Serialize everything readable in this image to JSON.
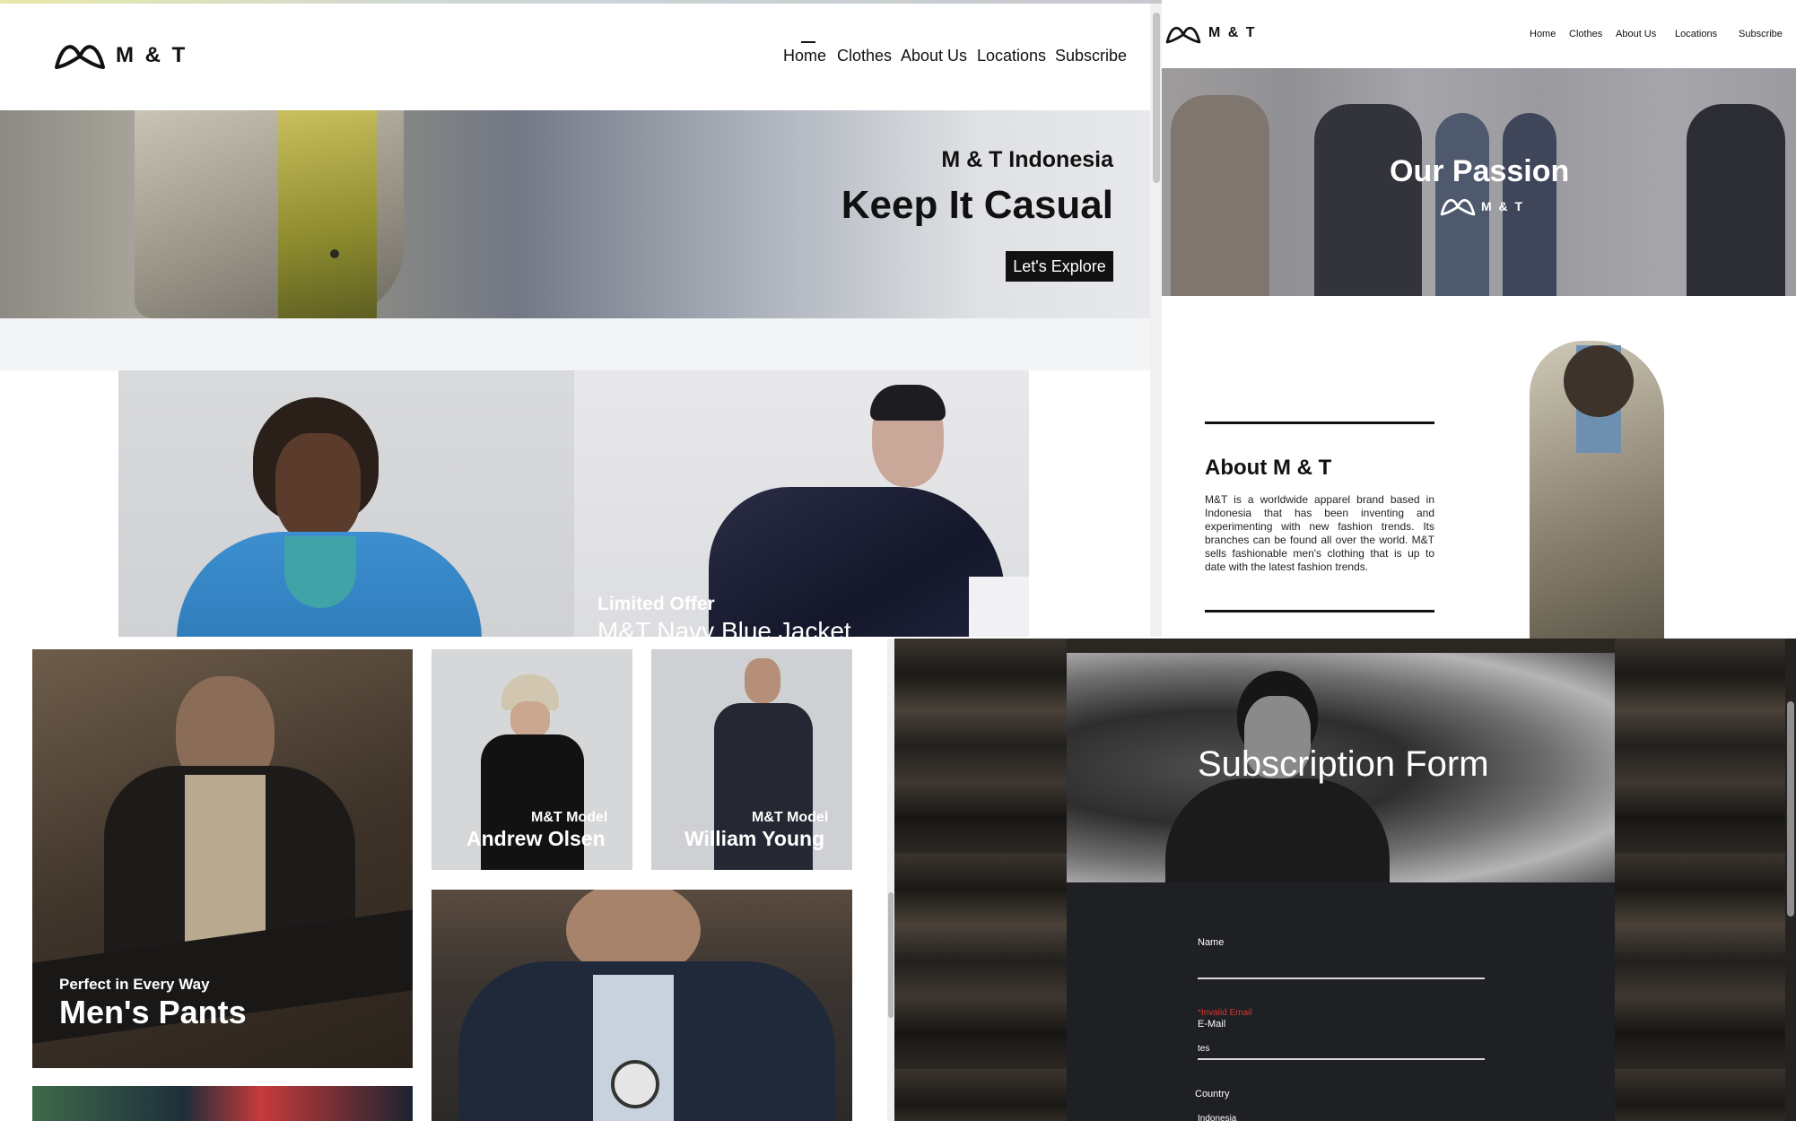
{
  "brand": {
    "logo_text": "M & T",
    "logo_small": "M & T"
  },
  "home": {
    "nav": [
      "Home",
      "Clothes",
      "About Us",
      "Locations",
      "Subscribe"
    ],
    "hero": {
      "subtitle": "M & T Indonesia",
      "title": "Keep It Casual",
      "cta": "Let's Explore"
    },
    "offer": {
      "label": "Limited Offer",
      "product": "M&T Navy Blue Jacket"
    }
  },
  "passion": {
    "nav": [
      "Home",
      "Clothes",
      "About Us",
      "Locations",
      "Subscribe"
    ],
    "banner_title": "Our Passion",
    "banner_logo_text": "M & T",
    "about_title": "About M & T",
    "about_text": "M&T is a worldwide apparel brand based in Indonesia that has been inventing and experimenting with new fashion trends. Its branches can be found all over the world. M&T sells fashionable men's clothing that is up to date with the latest fashion trends."
  },
  "gallery": {
    "pants": {
      "kicker": "Perfect in Every Way",
      "title": "Men's Pants"
    },
    "models": [
      {
        "kicker": "M&T Model",
        "name": "Andrew Olsen"
      },
      {
        "kicker": "M&T Model",
        "name": "William Young"
      }
    ]
  },
  "subscription": {
    "title": "Subscription Form",
    "name_label": "Name",
    "email_error": "*Invalid Email",
    "email_label": "E-Mail",
    "email_value": "tes",
    "country_label": "Country",
    "country_value": "Indonesia"
  },
  "colors": {
    "error": "#d9362b",
    "dark": "#111111",
    "form_bg": "#1e2024"
  },
  "icons": [
    "mt-logo-icon",
    "scroll-up-arrow-icon",
    "scroll-down-arrow-icon"
  ]
}
